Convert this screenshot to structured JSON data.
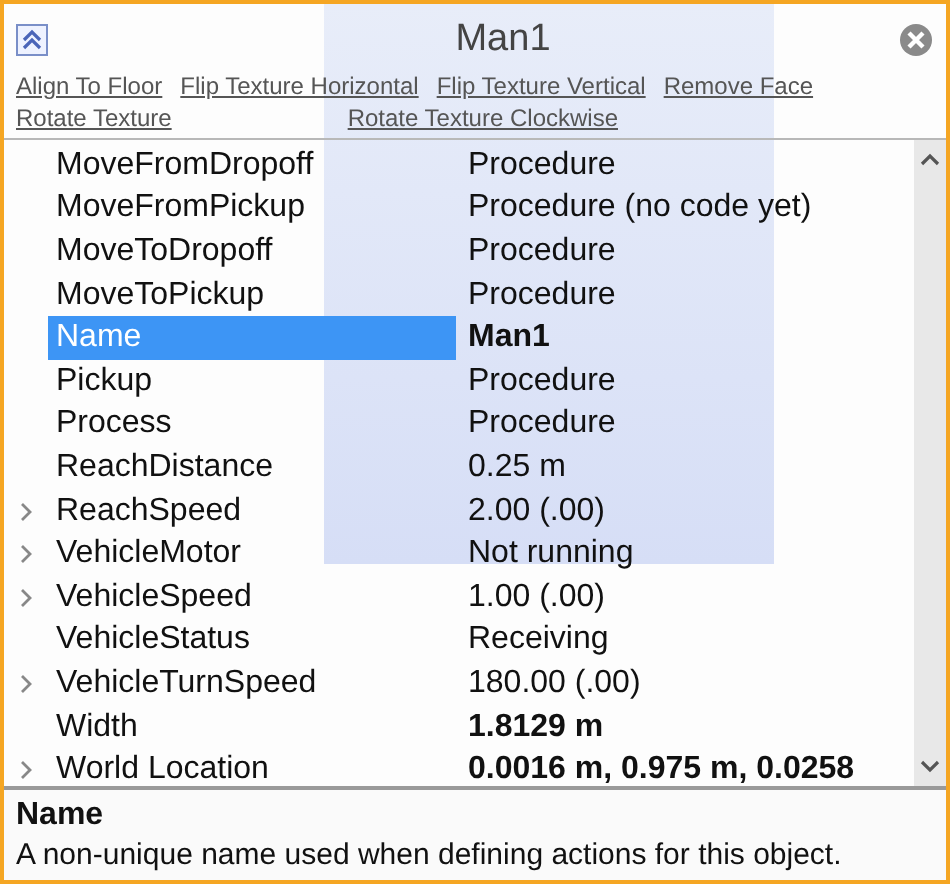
{
  "title": "Man1",
  "actions": [
    "Align To Floor",
    "Flip Texture Horizontal",
    "Flip Texture Vertical",
    "Remove Face",
    "Rotate Texture",
    "Rotate Texture Clockwise"
  ],
  "properties": [
    {
      "name": "MoveFromDropoff",
      "value": "Procedure",
      "expandable": false,
      "bold": false,
      "selected": false
    },
    {
      "name": "MoveFromPickup",
      "value": "Procedure (no code yet)",
      "expandable": false,
      "bold": false,
      "selected": false
    },
    {
      "name": "MoveToDropoff",
      "value": "Procedure",
      "expandable": false,
      "bold": false,
      "selected": false
    },
    {
      "name": "MoveToPickup",
      "value": "Procedure",
      "expandable": false,
      "bold": false,
      "selected": false
    },
    {
      "name": "Name",
      "value": "Man1",
      "expandable": false,
      "bold": true,
      "selected": true
    },
    {
      "name": "Pickup",
      "value": "Procedure",
      "expandable": false,
      "bold": false,
      "selected": false
    },
    {
      "name": "Process",
      "value": "Procedure",
      "expandable": false,
      "bold": false,
      "selected": false
    },
    {
      "name": "ReachDistance",
      "value": "0.25 m",
      "expandable": false,
      "bold": false,
      "selected": false
    },
    {
      "name": "ReachSpeed",
      "value": "2.00 (.00)",
      "expandable": true,
      "bold": false,
      "selected": false
    },
    {
      "name": "VehicleMotor",
      "value": "Not running",
      "expandable": true,
      "bold": false,
      "selected": false
    },
    {
      "name": "VehicleSpeed",
      "value": "1.00 (.00)",
      "expandable": true,
      "bold": false,
      "selected": false
    },
    {
      "name": "VehicleStatus",
      "value": "Receiving",
      "expandable": false,
      "bold": false,
      "selected": false
    },
    {
      "name": "VehicleTurnSpeed",
      "value": "180.00 (.00)",
      "expandable": true,
      "bold": false,
      "selected": false
    },
    {
      "name": "Width",
      "value": "1.8129 m",
      "expandable": false,
      "bold": true,
      "selected": false
    },
    {
      "name": "World Location",
      "value": "0.0016 m, 0.975 m, 0.0258",
      "expandable": true,
      "bold": true,
      "selected": false
    }
  ],
  "description": {
    "title": "Name",
    "text": "A non-unique name used when defining actions for this object."
  }
}
